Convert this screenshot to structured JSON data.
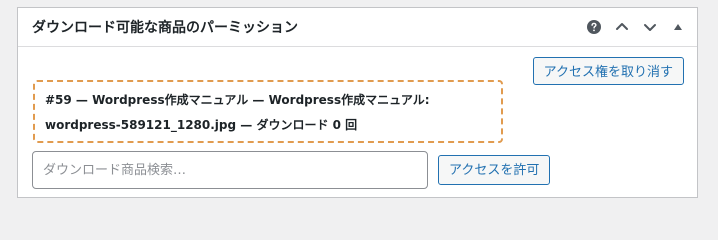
{
  "metabox": {
    "title": "ダウンロード可能な商品のパーミッション",
    "controls": {
      "help_icon": "question-mark-circle",
      "move_up_icon": "chevron-up",
      "move_down_icon": "chevron-down",
      "collapse_icon": "triangle-up"
    }
  },
  "actions": {
    "revoke_access_label": "アクセス権を取り消す",
    "grant_access_label": "アクセスを許可"
  },
  "permission": {
    "text": "#59 — Wordpress作成マニュアル — Wordpress作成マニュアル: wordpress-589121_1280.jpg — ダウンロード 0 回"
  },
  "search": {
    "placeholder": "ダウンロード商品検索…"
  },
  "colors": {
    "accent": "#2271b1",
    "highlight_border": "#e19b4f",
    "page_bg": "#f0f0f1"
  }
}
